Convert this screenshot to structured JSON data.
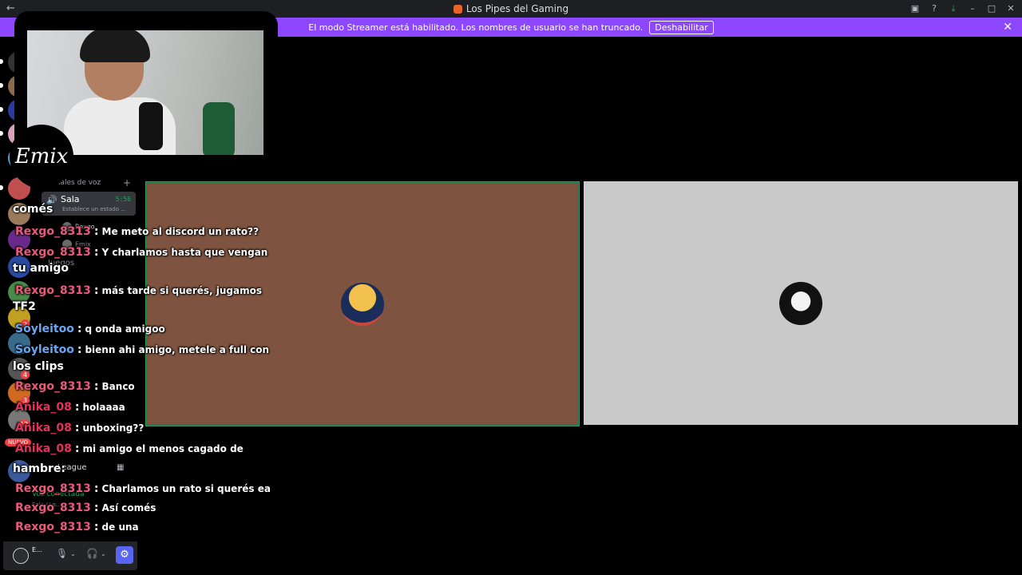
{
  "window": {
    "title": "Los Pipes del Gaming",
    "back_icon": "arrow-left-icon",
    "controls": [
      "inbox-icon",
      "help-icon",
      "download-icon",
      "minimize-icon",
      "maximize-icon",
      "close-icon"
    ]
  },
  "banner": {
    "message": "El modo Streamer está habilitado. Los nombres de usuario se han truncado.",
    "button_label": "Deshabilitar",
    "close_label": "✕"
  },
  "overlay": {
    "logo_text": "Emix"
  },
  "sidebar": {
    "category_label": "Canales de voz",
    "add_label": "+",
    "voice_channel": {
      "name": "Sala",
      "timer": "5:56",
      "status": "Establece un estado ..."
    },
    "members": [
      {
        "name": "Rexgo"
      },
      {
        "name": "Emix"
      }
    ],
    "other_channel": "Juegos",
    "league_label": "League",
    "voice_connected": "Voz conectada",
    "voice_sub": "Sala / Lo...",
    "new_badge": "NUEVO",
    "server_badges": [
      "1",
      "2",
      "4",
      "3",
      "12"
    ]
  },
  "user_panel": {
    "name": "E..."
  },
  "chat_messages": [
    {
      "user": "Rexgo_8313",
      "color": "#e85a7a",
      "text": "Me meto al discord un rato??"
    },
    {
      "user": "Rexgo_8313",
      "color": "#e85a7a",
      "text": "Y charlamos hasta que vengan"
    },
    {
      "user": "Rexgo_8313",
      "color": "#e85a7a",
      "text": "más tarde si querés, jugamos"
    },
    {
      "user": "Soyleitoo",
      "color": "#6aa6f0",
      "text": "q onda amigoo"
    },
    {
      "user": "Soyleitoo",
      "color": "#6aa6f0",
      "text": "bienn ahi amigo, metele a full con"
    },
    {
      "user": "Rexgo_8313",
      "color": "#e85a7a",
      "text": "Banco"
    },
    {
      "user": "Anika_08",
      "color": "#e8315a",
      "text": "holaaaa"
    },
    {
      "user": "Anika_08",
      "color": "#e8315a",
      "text": "unboxing??"
    },
    {
      "user": "Anika_08",
      "color": "#e8315a",
      "text": "mi amigo el menos cagado de"
    },
    {
      "user": "Rexgo_8313",
      "color": "#e85a7a",
      "text": "Charlamos un rato si querés ea"
    },
    {
      "user": "Rexgo_8313",
      "color": "#e85a7a",
      "text": "Así comés"
    },
    {
      "user": "Rexgo_8313",
      "color": "#e85a7a",
      "text": "de una"
    }
  ],
  "chat_wraps": [
    "comés",
    "tu amigo",
    "TF2",
    "los clips",
    "hambre:"
  ],
  "tiles": [
    {
      "name": "Rexgo",
      "bg": "#7e5340",
      "speaking": true
    },
    {
      "name": "Emix",
      "bg": "#c9c9c9",
      "speaking": false
    }
  ]
}
